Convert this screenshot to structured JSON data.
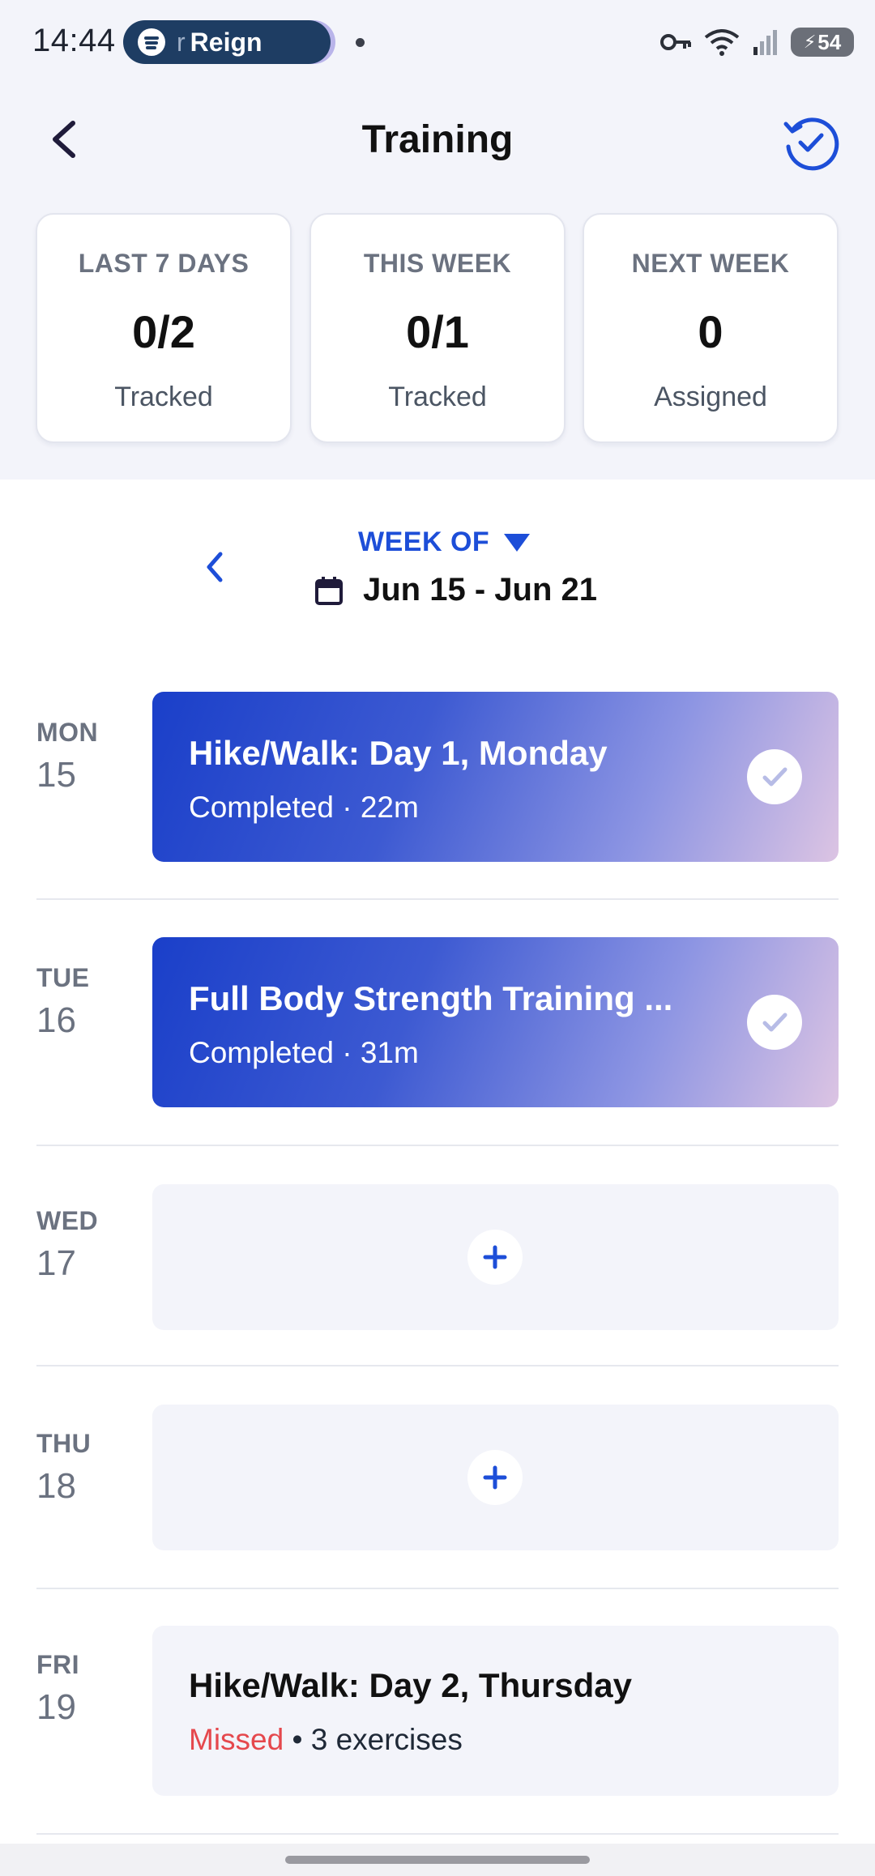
{
  "status_bar": {
    "time": "14:44",
    "media_prefix": "r",
    "media_title": "Reign",
    "battery": "54"
  },
  "header": {
    "title": "Training",
    "back_icon": "chevron-left-icon",
    "history_icon": "history-check-icon"
  },
  "stats": [
    {
      "label": "LAST 7 DAYS",
      "value": "0/2",
      "sub": "Tracked"
    },
    {
      "label": "THIS WEEK",
      "value": "0/1",
      "sub": "Tracked"
    },
    {
      "label": "NEXT WEEK",
      "value": "0",
      "sub": "Assigned"
    }
  ],
  "week": {
    "label": "WEEK OF",
    "range": "Jun 15 - Jun 21"
  },
  "days": [
    {
      "day": "MON",
      "date": "15",
      "type": "completed",
      "title": "Hike/Walk: Day 1, Monday",
      "status": "Completed",
      "duration": "22m"
    },
    {
      "day": "TUE",
      "date": "16",
      "type": "completed",
      "title": "Full Body Strength Training ...",
      "status": "Completed",
      "duration": "31m"
    },
    {
      "day": "WED",
      "date": "17",
      "type": "empty"
    },
    {
      "day": "THU",
      "date": "18",
      "type": "empty"
    },
    {
      "day": "FRI",
      "date": "19",
      "type": "missed",
      "title": "Hike/Walk: Day 2, Thursday",
      "status": "Missed",
      "detail": "3 exercises"
    }
  ],
  "colors": {
    "accent": "#1d4ed8",
    "missed": "#e5484d",
    "header_bg": "#f3f4fa"
  }
}
